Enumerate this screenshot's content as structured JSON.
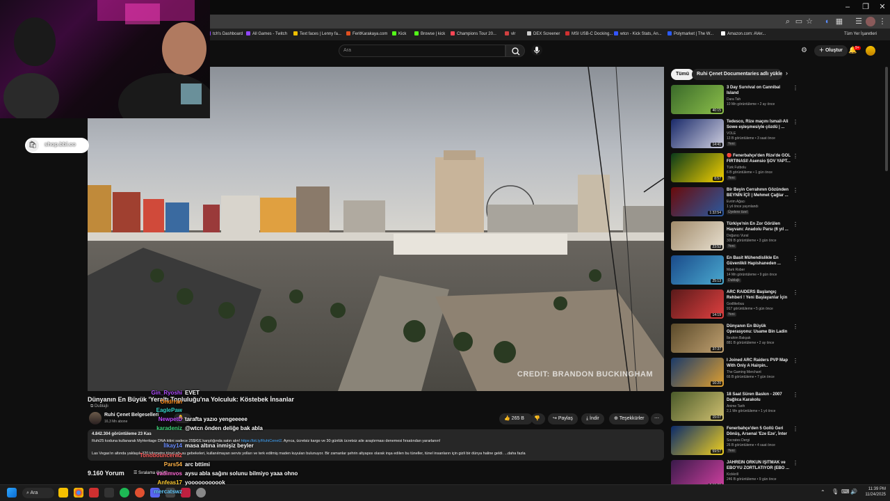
{
  "browser": {
    "bookmarks_label": "Tüm Yer İşaretleri",
    "bookmarks": [
      {
        "label": "tch's Dashboard",
        "color": "#9146ff"
      },
      {
        "label": "All Games - Twitch",
        "color": "#9146ff"
      },
      {
        "label": "Text faces | Lenny fa...",
        "color": "#f0c000"
      },
      {
        "label": "FeritKarakaya.com",
        "color": "#e05020"
      },
      {
        "label": "Kick",
        "color": "#53fc18"
      },
      {
        "label": "Browse | kick",
        "color": "#53fc18"
      },
      {
        "label": "Champions Tour 20...",
        "color": "#ff4655"
      },
      {
        "label": "vlr",
        "color": "#d04040"
      },
      {
        "label": "DEX Screener",
        "color": "#cccccc"
      },
      {
        "label": "MSI USB-C Docking...",
        "color": "#d03030"
      },
      {
        "label": "wtcn - Kick Stats, An...",
        "color": "#3355ff"
      },
      {
        "label": "Polymarket | The W...",
        "color": "#2a5bff"
      },
      {
        "label": "Amazon.com: AVer...",
        "color": "#ffffff"
      }
    ]
  },
  "header": {
    "search_placeholder": "Ara",
    "create_label": "Oluştur",
    "notif_count": "9+"
  },
  "webcam": {
    "shop_label": "shop.bbl.co"
  },
  "video": {
    "watermark": "CREDIT: BRANDON BUCKINGHAM",
    "title": "Dünyanın En Büyük 'Yeraltı Topluluğu'na Yolculuk: Köstebek İnsanlar",
    "dubbed_label": "Dublajlı",
    "channel": "Ruhi Çenet Belgeselleri",
    "subscribers": "16,3 Mn abone",
    "like_count": "265 B",
    "share_label": "Paylaş",
    "download_label": "İndir",
    "thanks_label": "Teşekkürler",
    "desc_meta": "4.842.304 görüntüleme  23 Kas",
    "desc_line1_a": "Ruhi25 koduna kullanarak MyHeritage DNA kitini sadece 25$/€/£ karşılığında satın alın! ",
    "desc_link": "https://bit.ly/RuhiCenet2",
    "desc_line1_b": ". Ayrıca, ücretsiz kargo ve 30 günlük ücretsiz aile araştırması denemesi fırsatından yararlanın!",
    "desc_line2": "Las Vegas'ın altında yaklaşık 320 kilometre tünel ağı su gebekeleri, kullanılmayan servis yolları ve terk edilmiş maden kuyuları bulunuyor. Bir zamanlar şehrin altyapısı olarak inşa edilen bu tüneller, tünel insanların için gizli bir dünya haline geldi. ...daha fazla",
    "comments_count": "9.160 Yorum",
    "sort_label": "Sıralama ölçütü"
  },
  "chat": [
    {
      "user": "Gin_Ryoshi",
      "color": "#b04cff",
      "msg": "EVET"
    },
    {
      "user": "Ondrran",
      "color": "#ff8c1a",
      "msg": ""
    },
    {
      "user": "EaglePaw",
      "color": "#35d1c6",
      "msg": ""
    },
    {
      "user": "NewpetD",
      "color": "#c04cff",
      "msg": "tarafta yazıo yengeeeee"
    },
    {
      "user": "karadeniz",
      "color": "#3fd27a",
      "msg": "@wtcn önden deliğe bak abla"
    },
    {
      "user": "İlkay14",
      "color": "#6a8cff",
      "msg": "masa altına inmişiz beyler"
    },
    {
      "user": "Tonobouncerw2",
      "color": "#ff5a5a",
      "msg": ""
    },
    {
      "user": "Pars54",
      "color": "#ffb347",
      "msg": "arc bttimi"
    },
    {
      "user": "vadimvos",
      "color": "#ff6ad5",
      "msg": "aysu abla sağını solunu bilmiyo yaaa ohno"
    },
    {
      "user": "Anfeas17",
      "color": "#ffcc33",
      "msg": "yooooooooook"
    },
    {
      "user": "mercatswz",
      "color": "#66ccff",
      "msg": ""
    }
  ],
  "sidebar": {
    "chips": [
      "Tümü",
      "Ruhi Çenet Documentaries adlı yükleyiciden"
    ],
    "suggestions": [
      {
        "title": "3 Day Survival on Cannibal Island",
        "channel": "Dara Tah",
        "meta": "10 Mn görüntüleme • 2 ay önce",
        "duration": "40:15",
        "badge": "",
        "color1": "#3a6a2a",
        "color2": "#8cbf4a"
      },
      {
        "title": "Tedesco, Rize maçını İsmail-Ali Sowe eşleşmesiyle çözdü | ...",
        "channel": "VOLE",
        "meta": "13 B görüntüleme • 3 saat önce",
        "duration": "14:41",
        "badge": "Yeni",
        "color1": "#1a2a6a",
        "color2": "#d0d0e0"
      },
      {
        "title": "🔴 Fenerbahçe'den Rize'de GOL FIRTINASI! Asensio ŞOV YAPT...",
        "channel": "Türk Futbolu",
        "meta": "6 B görüntüleme • 1 gün önce",
        "duration": "8:57",
        "badge": "Yeni",
        "color1": "#0a3a1a",
        "color2": "#f5d000"
      },
      {
        "title": "Bir Beyin Cerrahının Gözünden BEYNİN İÇİ! | Mehmet Çağlar ...",
        "channel": "Evrim Ağacı",
        "meta": "1 yıl önce yayınlandı",
        "duration": "1:32:54",
        "badge": "Üyelere özel",
        "color1": "#6a0a0a",
        "color2": "#2a5aa0"
      },
      {
        "title": "Türkiye'nin En Zor Görülen Hayvanı: Anadolu Parsı (6 yıl ...",
        "channel": "Doğancı Vural",
        "meta": "309 B görüntüleme • 3 gün önce",
        "duration": "23:52",
        "badge": "Yeni",
        "color1": "#a08a6a",
        "color2": "#e8e0d0"
      },
      {
        "title": "En Basit Mühendislikle En Güvenlikli Hapishaneden ...",
        "channel": "Mark Rober",
        "meta": "14 Mn görüntüleme • 9 gün önce",
        "duration": "25:13",
        "badge": "Dublajlı",
        "color1": "#1a4a8a",
        "color2": "#4aaad0"
      },
      {
        "title": "ARC RAIDERS Başlangıç Rehberi ! Yeni Başlayanlar İçin ...",
        "channel": "Godlikebuu",
        "meta": "917 görüntüleme • 5 gün önce",
        "duration": "14:19",
        "badge": "Yeni",
        "color1": "#5a1a1a",
        "color2": "#e04040"
      },
      {
        "title": "Dünyanın En Büyük Operasyonu: Usame Bin Ladin Gerçekten ...",
        "channel": "İbrahim Bakşak",
        "meta": "881 B görüntüleme • 2 ay önce",
        "duration": "37:37",
        "badge": "",
        "color1": "#5a4a2a",
        "color2": "#c0a070"
      },
      {
        "title": "I Joined ARC Raiders PVP Map With Only A Hairpin..",
        "channel": "The Gaming Merchant",
        "meta": "66 B görüntüleme • 7 gün önce",
        "duration": "16:20",
        "badge": "",
        "color1": "#1a3a6a",
        "color2": "#e0a030"
      },
      {
        "title": "18 Saat Süren Baskın - 2007 Dağlıca Karakolu",
        "channel": "Anime Tarih",
        "meta": "2,1 Mn görüntüleme • 1 yıl önce",
        "duration": "15:07",
        "badge": "",
        "color1": "#4a5a2a",
        "color2": "#d0c070"
      },
      {
        "title": "Fenerbahçe'den 5 Gollü Geri Dönüş, Arsenal 'Eze Eze', İnter ...",
        "channel": "Socrates Dergi",
        "meta": "26 B görüntüleme • 4 saat önce",
        "duration": "59:57",
        "badge": "Yeni",
        "color1": "#0a2a6a",
        "color2": "#f0d020"
      },
      {
        "title": "JAHREIN ORKUN IŞITMAK ve EBO'YU ZORTLATIYOR (EBO ...",
        "channel": "Kickkrill",
        "meta": "246 B görüntüleme • 9 gün önce",
        "duration": "2:13:39",
        "badge": "",
        "color1": "#3a1a4a",
        "color2": "#d040a0"
      }
    ]
  },
  "taskbar": {
    "search_label": "Ara",
    "time": "11:39 PM",
    "date": "11/24/2025"
  }
}
